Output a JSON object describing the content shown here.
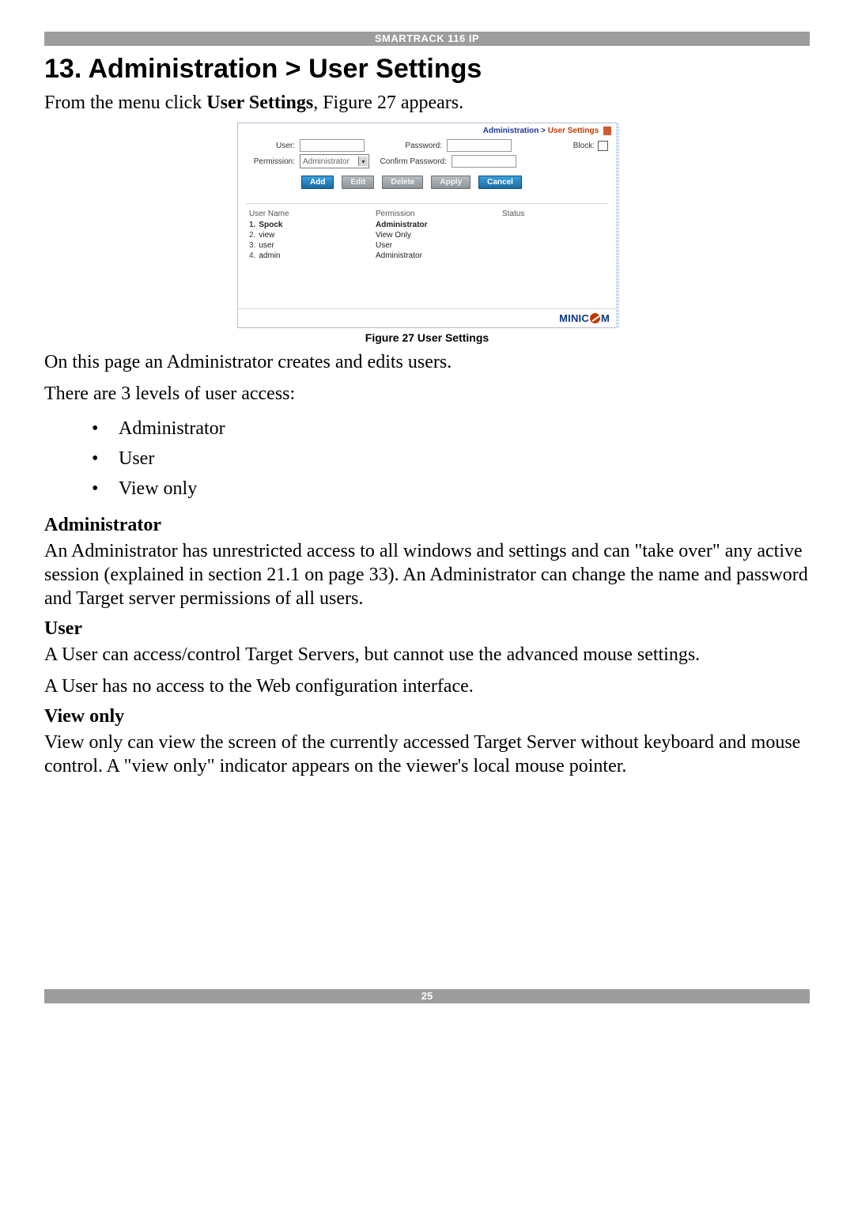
{
  "header": {
    "product": "SMARTRACK 116 IP"
  },
  "title": "13. Administration > User Settings",
  "intro_a": "From the menu click ",
  "intro_b": "User Settings",
  "intro_c": ", Figure 27 appears.",
  "fig": {
    "crumb1": "Administration > ",
    "crumb2": "User Settings",
    "labels": {
      "user": "User:",
      "password": "Password:",
      "permission": "Permission:",
      "confirm": "Confirm Password:",
      "block": "Block:"
    },
    "perm_sel": "Administrator",
    "buttons": {
      "add": "Add",
      "edit": "Edit",
      "delete": "Delete",
      "apply": "Apply",
      "cancel": "Cancel"
    },
    "cols": {
      "c1": "User Name",
      "c2": "Permission",
      "c3": "Status"
    },
    "rows": [
      {
        "n": "1.",
        "name": "Spock",
        "perm": "Administrator",
        "status": "",
        "sel": true
      },
      {
        "n": "2.",
        "name": "view",
        "perm": "View Only",
        "status": "",
        "sel": false
      },
      {
        "n": "3.",
        "name": "user",
        "perm": "User",
        "status": "",
        "sel": false
      },
      {
        "n": "4.",
        "name": "admin",
        "perm": "Administrator",
        "status": "",
        "sel": false
      }
    ],
    "logo_a": "MINIC",
    "logo_b": "M",
    "caption": "Figure 27 User Settings"
  },
  "p_after1": "On this page an Administrator creates and edits users.",
  "p_after2": "There are 3 levels of user access:",
  "levels": [
    "Administrator",
    "User",
    "View only"
  ],
  "admin_h": "Administrator",
  "admin_p": "An Administrator has unrestricted access to all windows and settings and can \"take over\" any active session (explained in section 21.1 on page 33). An Administrator can change the name and password and Target server permissions of all users.",
  "user_h": "User",
  "user_p1": "A User can access/control Target Servers, but cannot use the advanced mouse settings.",
  "user_p2": "A User has no access to the Web configuration interface.",
  "view_h": "View only",
  "view_p": "View only can view the screen of the currently accessed Target Server without keyboard and mouse control. A \"view only\" indicator appears on the viewer's local mouse pointer.",
  "footer": {
    "page": "25"
  }
}
